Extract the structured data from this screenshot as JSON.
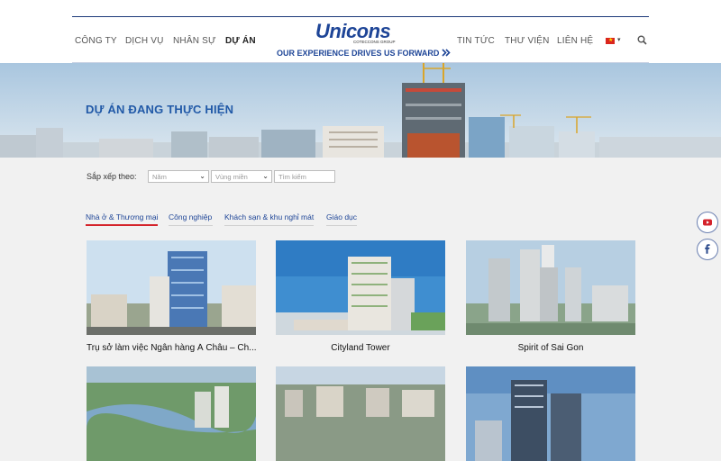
{
  "nav_left": [
    "CÔNG TY",
    "DỊCH VỤ",
    "NHÂN SỰ",
    "DỰ ÁN"
  ],
  "nav_right": [
    "TIN TỨC",
    "THƯ VIỆN",
    "LIÊN HỆ"
  ],
  "logo": {
    "text": "Unicons",
    "sub": "COTECCONS GROUP"
  },
  "tagline": "OUR EXPERIENCE DRIVES US FORWARD",
  "banner_title": "DỰ ÁN ĐANG THỰC HIỆN",
  "filter": {
    "label": "Sắp xếp theo:",
    "year_placeholder": "Năm",
    "region_placeholder": "Vùng miền",
    "search_placeholder": "Tìm kiếm"
  },
  "tabs": [
    "Nhà ở & Thương mại",
    "Công nghiệp",
    "Khách sạn & khu nghỉ mát",
    "Giáo dục"
  ],
  "active_tab": 0,
  "projects": [
    {
      "title": "Trụ sở làm việc Ngân hàng Á Châu – Ch..."
    },
    {
      "title": "Cityland Tower"
    },
    {
      "title": "Spirit of Sai Gon"
    },
    {
      "title": ""
    },
    {
      "title": ""
    },
    {
      "title": ""
    }
  ],
  "colors": {
    "brand_blue": "#1e4597",
    "brand_red": "#d4232b",
    "banner_title": "#2159a7"
  },
  "icons": [
    "search-icon",
    "vietnam-flag-icon",
    "youtube-icon",
    "facebook-icon"
  ]
}
